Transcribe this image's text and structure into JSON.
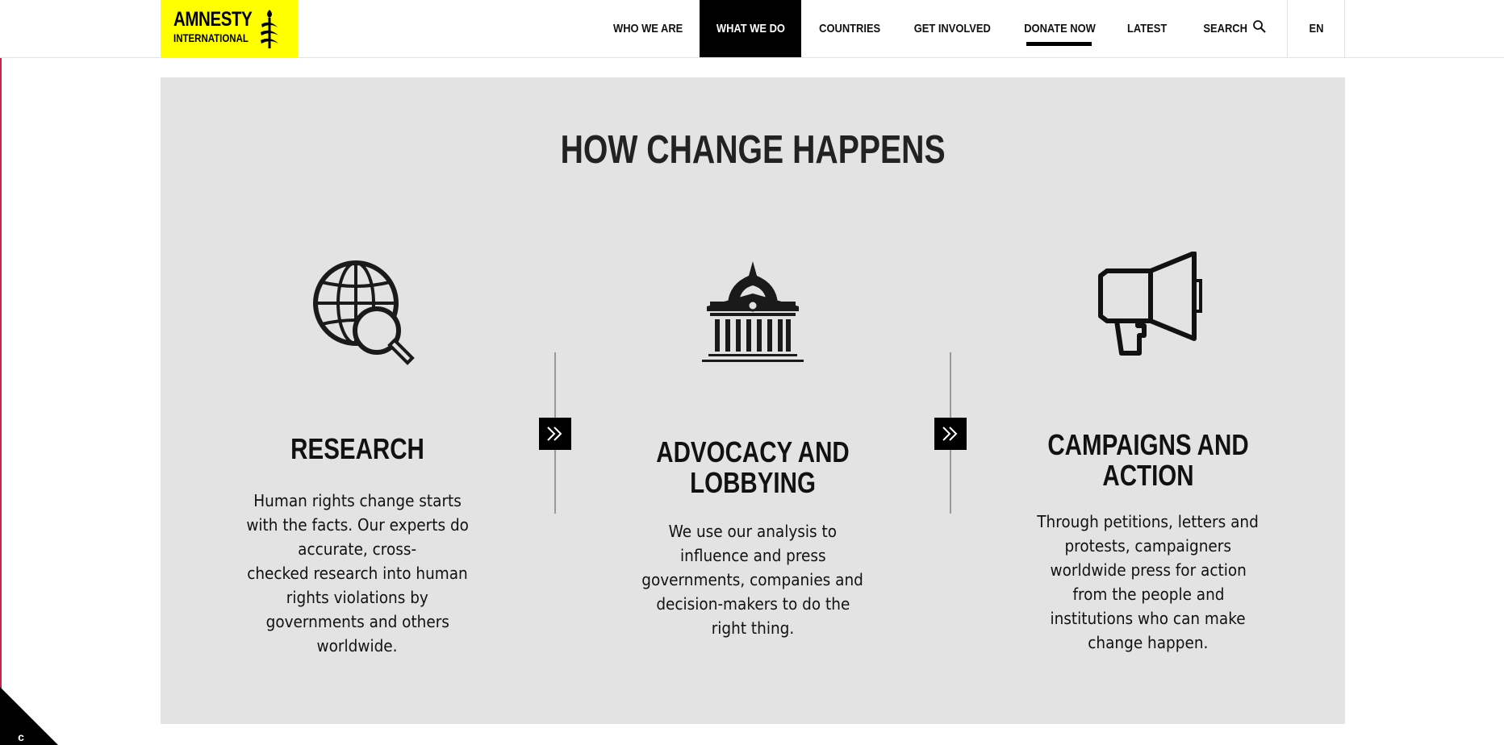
{
  "logo": {
    "line1": "AMNESTY",
    "line2": "INTERNATIONAL",
    "icon": "candle-icon",
    "color": "#ffff00"
  },
  "nav": {
    "items": [
      {
        "label": "WHO WE ARE"
      },
      {
        "label": "WHAT WE DO",
        "active": true
      },
      {
        "label": "COUNTRIES"
      },
      {
        "label": "GET INVOLVED"
      },
      {
        "label": "DONATE NOW"
      },
      {
        "label": "LATEST"
      },
      {
        "label": "SEARCH",
        "icon": "search-icon"
      }
    ],
    "language": "EN"
  },
  "section": {
    "title": "HOW CHANGE HAPPENS",
    "steps": [
      {
        "icon": "globe-search-icon",
        "heading": "RESEARCH",
        "body": [
          "Human rights change starts",
          "with the facts. Our experts do",
          "accurate, cross-",
          "checked research into human",
          "rights violations by",
          "governments and others",
          "worldwide."
        ]
      },
      {
        "icon": "government-building-icon",
        "heading": [
          "ADVOCACY AND",
          "LOBBYING"
        ],
        "body": [
          "We use our analysis to",
          "influence and press",
          "governments, companies and",
          "decision-makers to do the",
          "right thing."
        ]
      },
      {
        "icon": "megaphone-icon",
        "heading": [
          "CAMPAIGNS AND",
          "ACTION"
        ],
        "body": [
          "Through petitions, letters and",
          "protests, campaigners",
          "worldwide press for action",
          "from the people and",
          "institutions who can make",
          "change happen."
        ]
      }
    ],
    "arrow_icon": "double-chevron-right-icon"
  },
  "colors": {
    "panel": "#e3e3e3",
    "text": "#111111",
    "accent": "#ffff00",
    "nav_active": "#000000"
  },
  "cookie": {
    "icon": "cookie-settings-icon",
    "glyph": "c"
  }
}
